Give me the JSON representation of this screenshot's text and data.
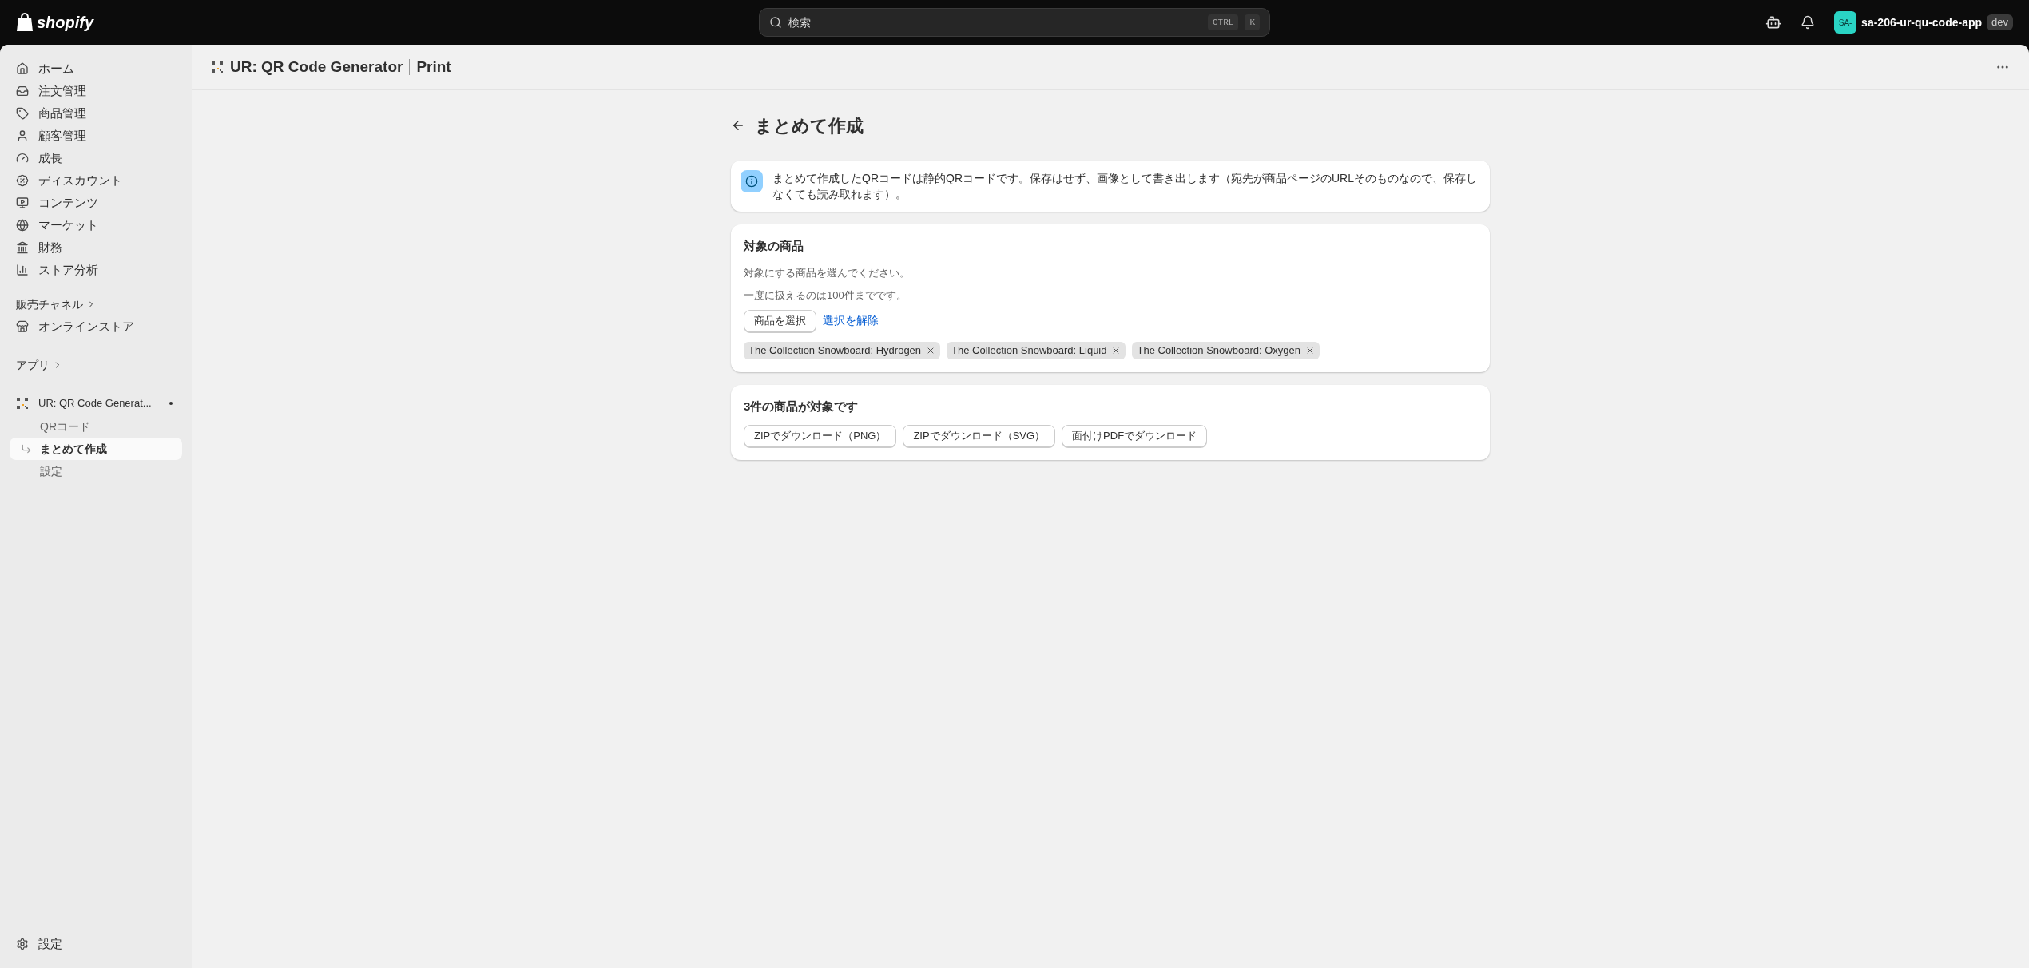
{
  "topbar": {
    "logo": "shopify",
    "search": {
      "placeholder": "検索",
      "shortcut": [
        "CTRL",
        "K"
      ]
    },
    "store": {
      "avatar": "SA-",
      "name": "sa-206-ur-qu-code-app",
      "badge": "dev"
    }
  },
  "sidebar": {
    "items": [
      {
        "label": "ホーム"
      },
      {
        "label": "注文管理"
      },
      {
        "label": "商品管理"
      },
      {
        "label": "顧客管理"
      },
      {
        "label": "成長"
      },
      {
        "label": "ディスカウント"
      },
      {
        "label": "コンテンツ"
      },
      {
        "label": "マーケット"
      },
      {
        "label": "財務"
      },
      {
        "label": "ストア分析"
      }
    ],
    "channels_heading": "販売チャネル",
    "channels": [
      {
        "label": "オンラインストア"
      }
    ],
    "apps_heading": "アプリ",
    "app": {
      "label": "UR: QR Code Generat...",
      "children": [
        {
          "label": "QRコード",
          "selected": false
        },
        {
          "label": "まとめて作成",
          "selected": true
        },
        {
          "label": "設定",
          "selected": false
        }
      ]
    },
    "settings": "設定"
  },
  "header": {
    "app_name": "UR: QR Code Generator",
    "page": "Print"
  },
  "page": {
    "title": "まとめて作成",
    "banner": "まとめて作成したQRコードは静的QRコードです。保存はせず、画像として書き出します（宛先が商品ページのURLそのものなので、保存しなくても読み取れます）。",
    "products_card": {
      "title": "対象の商品",
      "lines": [
        "対象にする商品を選んでください。",
        "一度に扱えるのは100件までです。"
      ],
      "select_button": "商品を選択",
      "clear_link": "選択を解除",
      "tags": [
        "The Collection Snowboard: Hydrogen",
        "The Collection Snowboard: Liquid",
        "The Collection Snowboard: Oxygen"
      ]
    },
    "download_card": {
      "title": "3件の商品が対象です",
      "buttons": [
        "ZIPでダウンロード（PNG）",
        "ZIPでダウンロード（SVG）",
        "面付けPDFでダウンロード"
      ]
    }
  }
}
